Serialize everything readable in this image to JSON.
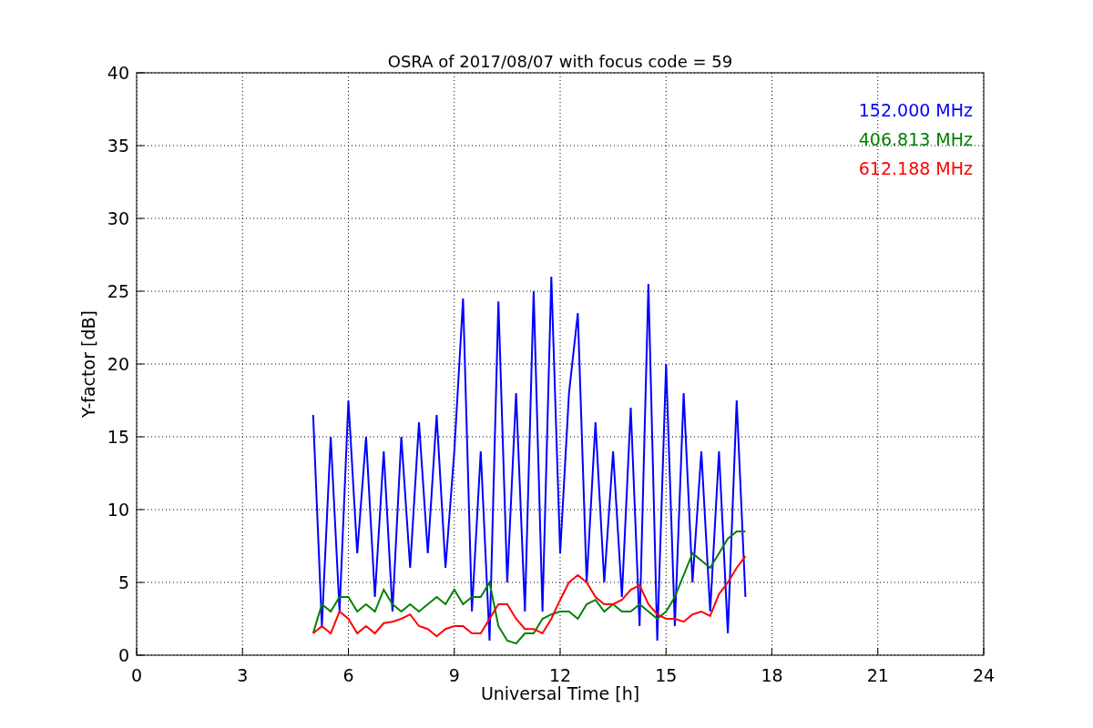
{
  "chart_data": {
    "type": "line",
    "title": "OSRA of 2017/08/07 with focus code = 59",
    "xlabel": "Universal Time [h]",
    "ylabel": "Y-factor [dB]",
    "x": [
      5,
      5.25,
      5.5,
      5.75,
      6,
      6.25,
      6.5,
      6.75,
      7,
      7.25,
      7.5,
      7.75,
      8,
      8.25,
      8.5,
      8.75,
      9,
      9.25,
      9.5,
      9.75,
      10,
      10.25,
      10.5,
      10.75,
      11,
      11.25,
      11.5,
      11.75,
      12,
      12.25,
      12.5,
      12.75,
      13,
      13.25,
      13.5,
      13.75,
      14,
      14.25,
      14.5,
      14.75,
      15,
      15.25,
      15.5,
      15.75,
      16,
      16.25,
      16.5,
      16.75,
      17,
      17.25
    ],
    "series": [
      {
        "name": "152.000 MHz",
        "color": "#0000ff",
        "values": [
          16.5,
          2,
          15,
          3,
          17.5,
          7,
          15,
          4,
          14,
          3,
          15,
          6,
          16,
          7,
          16.5,
          6,
          14,
          24.5,
          3,
          14,
          1,
          24.3,
          5,
          18,
          3,
          25,
          3,
          26,
          7,
          18,
          23.5,
          5,
          16,
          5,
          14,
          4,
          17,
          2,
          25.5,
          1,
          20,
          2,
          18,
          5,
          14,
          3,
          14,
          1.5,
          17.5,
          4
        ]
      },
      {
        "name": "406.813 MHz",
        "color": "#008000",
        "values": [
          1.5,
          3.5,
          3,
          4,
          4,
          3,
          3.5,
          3,
          4.5,
          3.5,
          3,
          3.5,
          3,
          3.5,
          4,
          3.5,
          4.5,
          3.5,
          4,
          4,
          5,
          2,
          1,
          0.8,
          1.5,
          1.5,
          2.5,
          2.8,
          3,
          3,
          2.5,
          3.5,
          3.8,
          3,
          3.5,
          3,
          3,
          3.5,
          3,
          2.5,
          3,
          4,
          5.5,
          7,
          6.5,
          6,
          7,
          8,
          8.5,
          8.5
        ]
      },
      {
        "name": "612.188 MHz",
        "color": "#ff0000",
        "values": [
          1.5,
          2,
          1.5,
          3,
          2.5,
          1.5,
          2,
          1.5,
          2.2,
          2.3,
          2.5,
          2.8,
          2,
          1.8,
          1.3,
          1.8,
          2,
          2,
          1.5,
          1.5,
          2.5,
          3.5,
          3.5,
          2.5,
          1.8,
          1.8,
          1.5,
          2.5,
          3.8,
          5,
          5.5,
          5,
          4,
          3.5,
          3.5,
          3.8,
          4.5,
          4.8,
          3.5,
          2.8,
          2.5,
          2.5,
          2.3,
          2.8,
          3,
          2.7,
          4.2,
          5,
          6,
          6.8
        ]
      }
    ],
    "xlim": [
      0,
      24
    ],
    "ylim": [
      0,
      40
    ],
    "xticks": [
      0,
      3,
      6,
      9,
      12,
      15,
      18,
      21,
      24
    ],
    "yticks": [
      0,
      5,
      10,
      15,
      20,
      25,
      30,
      35,
      40
    ],
    "grid": true
  }
}
